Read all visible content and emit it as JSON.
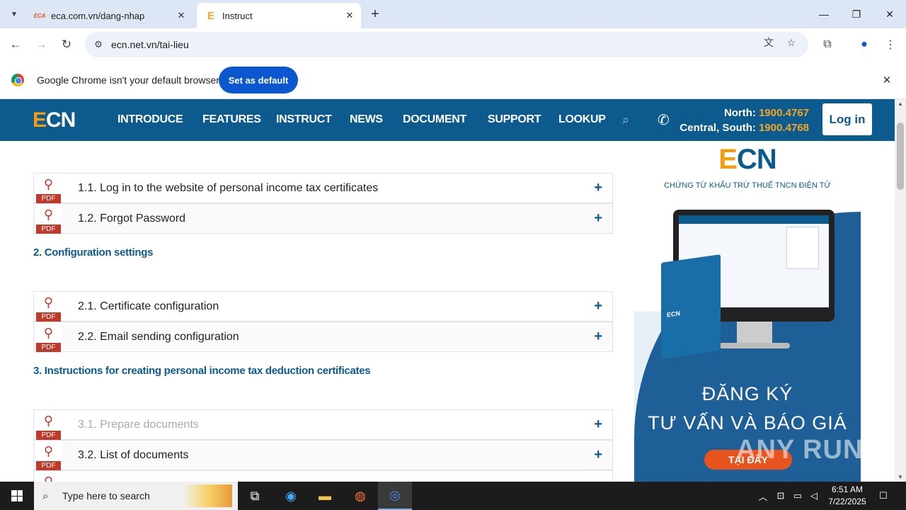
{
  "browser": {
    "tabs": [
      {
        "title": "eca.com.vn/dang-nhap",
        "favicon": "ECA"
      },
      {
        "title": "Instruct",
        "favicon": "E"
      }
    ],
    "url": "ecn.net.vn/tai-lieu",
    "infobar": {
      "message": "Google Chrome isn't your default browser",
      "button": "Set as default"
    }
  },
  "site": {
    "logo_e": "E",
    "logo_rest": "CN",
    "menu": [
      "INTRODUCE",
      "FEATURES",
      "INSTRUCT",
      "NEWS",
      "DOCUMENT",
      "SUPPORT",
      "LOOKUP"
    ],
    "hotline": {
      "north_label": "North: ",
      "north_number": "1900.4767",
      "central_label": "Central, South: ",
      "central_number": "1900.4768"
    },
    "login": "Log in"
  },
  "content": {
    "pdf_label": "PDF",
    "items_group1": [
      {
        "title": "1.1. Log in to the website of personal income tax certificates"
      },
      {
        "title": "1.2. Forgot Password"
      }
    ],
    "section2": "2. Configuration settings",
    "items_group2": [
      {
        "title": "2.1. Certificate configuration"
      },
      {
        "title": "2.2. Email sending configuration"
      }
    ],
    "section3": "3. Instructions for creating personal income tax deduction certificates",
    "items_group3": [
      {
        "title": "3.1. Prepare documents"
      },
      {
        "title": "3.2. List of documents"
      }
    ]
  },
  "ad": {
    "logo_e": "E",
    "logo_rest": "CN",
    "subtitle": "CHỨNG TỪ KHẤU TRỪ THUẾ TNCN ĐIỆN TỬ",
    "headline1": "ĐĂNG KÝ",
    "headline2": "TƯ VẤN VÀ BÁO GIÁ",
    "button": "TẠI ĐÂY",
    "box_label": "ECN"
  },
  "watermark": "ANY RUN",
  "taskbar": {
    "search_placeholder": "Type here to search",
    "time": "6:51 AM",
    "date": "7/22/2025"
  }
}
